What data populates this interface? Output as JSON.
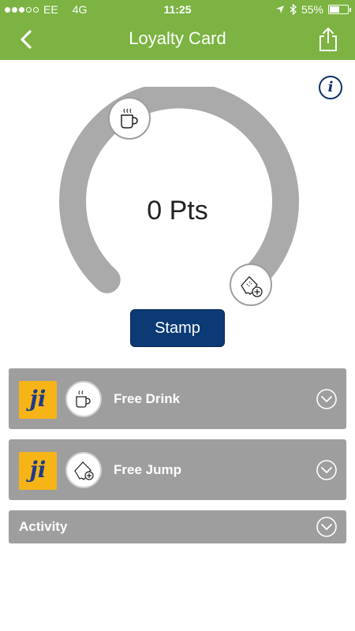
{
  "status_bar": {
    "carrier": "EE",
    "network": "4G",
    "time": "11:25",
    "battery": "55%",
    "battery_level": 0.55,
    "signal_bars_filled": 3,
    "signal_bars_total": 5
  },
  "header": {
    "title": "Loyalty Card",
    "back_icon": "chevron-left-icon",
    "share_icon": "share-icon"
  },
  "info": {
    "glyph": "i"
  },
  "card": {
    "points_text": "0 Pts",
    "start_icon": "coffee-cup-icon",
    "end_icon": "ticket-plus-icon",
    "stamp_label": "Stamp"
  },
  "rewards": [
    {
      "logo_text": "ji",
      "icon": "coffee-cup-icon",
      "label": "Free Drink"
    },
    {
      "logo_text": "ji",
      "icon": "ticket-plus-icon",
      "label": "Free Jump"
    }
  ],
  "activity": {
    "label": "Activity"
  },
  "colors": {
    "brand_green": "#7cb342",
    "stamp_blue": "#0b3a75",
    "panel_grey": "#9e9e9e",
    "logo_yellow": "#f6b417",
    "gauge_grey": "#aaaaaa"
  }
}
